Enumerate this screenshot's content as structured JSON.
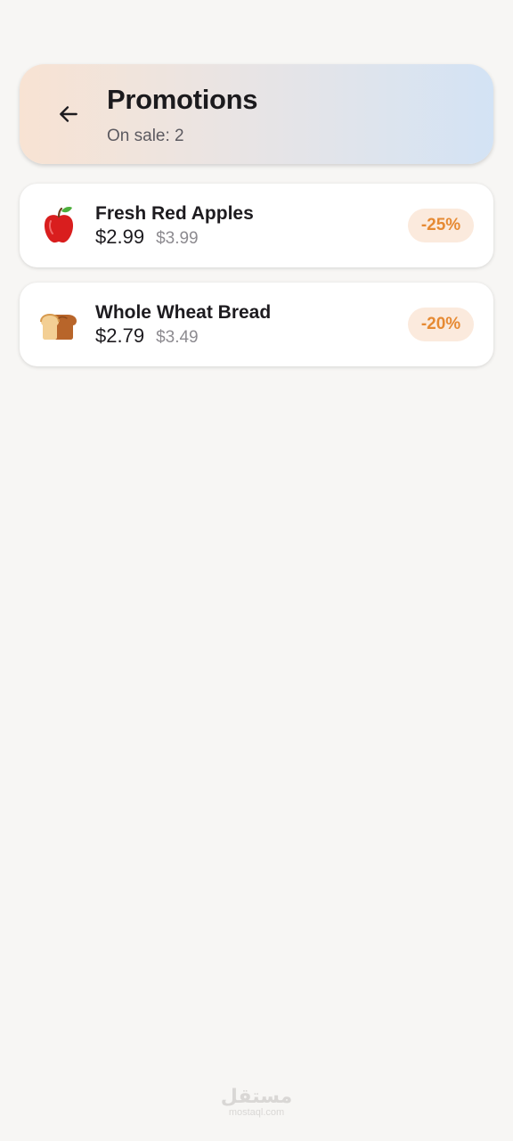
{
  "header": {
    "title": "Promotions",
    "subtitle": "On sale: 2",
    "back_icon": "arrow-left-icon",
    "gradient_colors": [
      "#f8e3d3",
      "#d3e3f5"
    ]
  },
  "promotions": [
    {
      "name": "Fresh Red Apples",
      "icon": "apple-icon",
      "price": "$2.99",
      "original_price": "$3.99",
      "discount": "-25%"
    },
    {
      "name": "Whole Wheat Bread",
      "icon": "bread-icon",
      "price": "$2.79",
      "original_price": "$3.49",
      "discount": "-20%"
    }
  ],
  "colors": {
    "background": "#f7f6f4",
    "badge_bg": "#fbeadd",
    "badge_text": "#e68a33"
  },
  "watermark": {
    "logo": "مستقل",
    "url": "mostaql.com"
  }
}
